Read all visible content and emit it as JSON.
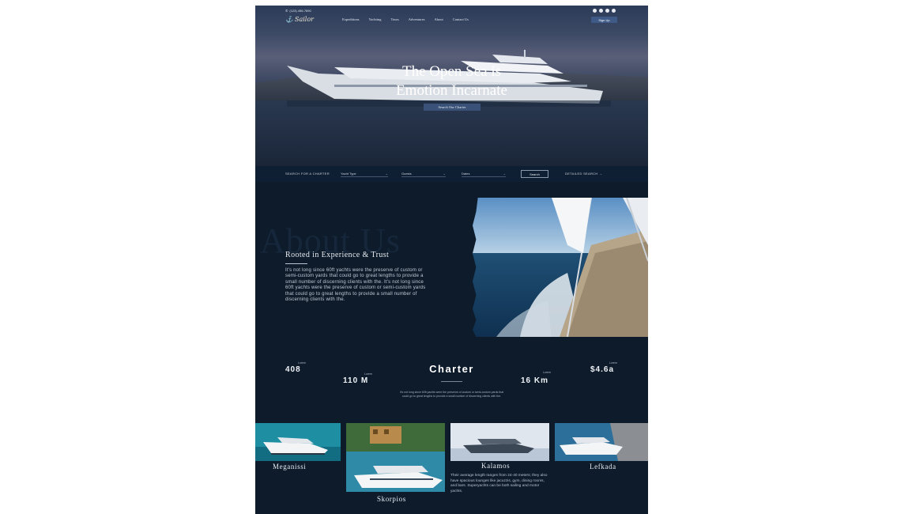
{
  "topbar": {
    "phone": "(123) 456-7890",
    "logo": "Sailor",
    "nav": [
      "Expeditions",
      "Yachting",
      "Tours",
      "Adventures",
      "About",
      "Contact Us"
    ],
    "signup_label": "Sign Up",
    "social_icons": [
      "facebook-icon",
      "twitter-icon",
      "instagram-icon",
      "youtube-icon"
    ]
  },
  "hero": {
    "title_line1": "The Open Sea is",
    "title_line2": "Emotion Incarnate",
    "cta_label": "Search Our Charter"
  },
  "search": {
    "label": "SEARCH FOR A CHARTER",
    "yacht_type": "Yacht Type",
    "guests": "Guests",
    "dates": "Dates",
    "button": "Search",
    "detailed": "DETAILED SEARCH"
  },
  "about": {
    "ghost": "About Us",
    "title": "Rooted in Experience & Trust",
    "text": "It's not long since 60ft yachts were the preserve of custom or semi-custom yards that could go to great lengths to provide a small number of discerning clients with the. It's not long since 60ft yachts were the preserve of custom or semi-custom yards that could go to great lengths to provide a small number of discerning clients with the."
  },
  "stats": [
    {
      "value": "408",
      "caption": "Lorem"
    },
    {
      "value": "110 M",
      "caption": "Lorem"
    },
    {
      "value": "16 Km",
      "caption": "Lorem"
    },
    {
      "value": "$4.6a",
      "caption": "Lorem"
    }
  ],
  "charter": {
    "title": "Charter",
    "text": "It's not long since 60ft yachts were the preserve of custom or semi-custom yards that could go to great lengths to provide a small number of discerning clients with the."
  },
  "destinations": [
    {
      "name": "Meganissi"
    },
    {
      "name": "Skorpios"
    },
    {
      "name": "Kalamos",
      "description": "Their average length ranges from 24-40 meters; they also have spacious lounges like jacuzzis, gym, dining rooms, and bars. Superyachts can be both sailing and motor yachts."
    },
    {
      "name": "Lefkada"
    }
  ],
  "colors": {
    "page_bg": "#0d1b2b",
    "accent": "#3a5278"
  }
}
